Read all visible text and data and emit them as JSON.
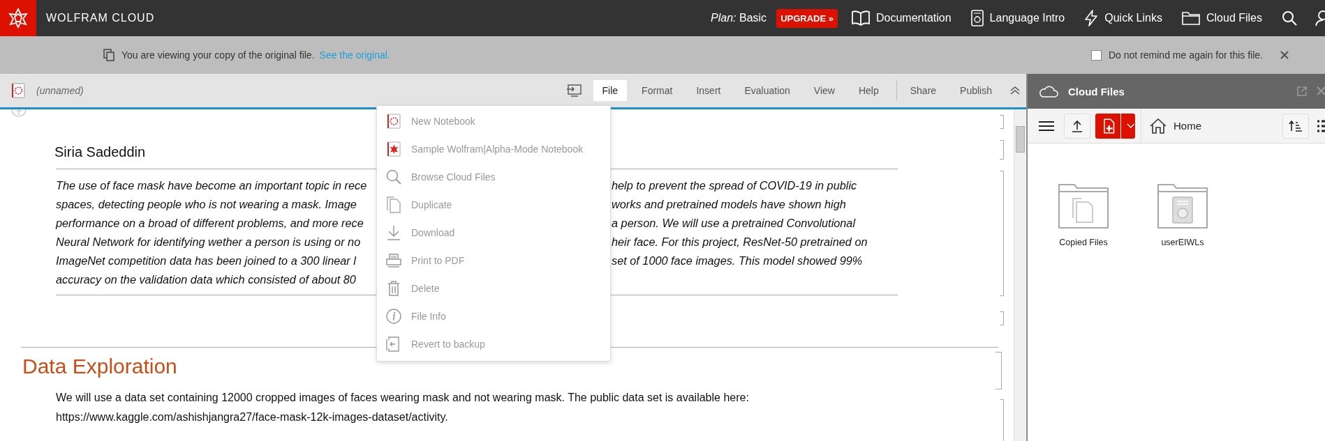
{
  "header": {
    "brand": "WOLFRAM CLOUD",
    "plan_label": "Plan:",
    "plan": "Basic",
    "upgrade": "UPGRADE »",
    "links": [
      {
        "kind": "book",
        "label": "Documentation"
      },
      {
        "kind": "intro",
        "label": "Language Intro"
      },
      {
        "kind": "bolt",
        "label": "Quick Links"
      },
      {
        "kind": "folder",
        "label": "Cloud Files"
      }
    ]
  },
  "notice": {
    "text": "You are viewing your copy of the original file.",
    "link": "See the original.",
    "remind": {
      "label": "Do not remind me again for this file.",
      "checked": false
    }
  },
  "notebook": {
    "title": "(unnamed)",
    "menus": [
      {
        "label": "File",
        "selected": true
      },
      {
        "label": "Format",
        "selected": false
      },
      {
        "label": "Insert",
        "selected": false
      },
      {
        "label": "Evaluation",
        "selected": false
      },
      {
        "label": "View",
        "selected": false
      },
      {
        "label": "Help",
        "selected": false
      }
    ],
    "actions": [
      "Share",
      "Publish"
    ]
  },
  "file_menu": [
    {
      "kind": "notebook",
      "label": "New Notebook",
      "disabled": true
    },
    {
      "kind": "wa-notebook",
      "label": "Sample Wolfram|Alpha-Mode Notebook",
      "disabled": true
    },
    {
      "kind": "search",
      "label": "Browse Cloud Files",
      "disabled": true
    },
    {
      "kind": "duplicate",
      "label": "Duplicate",
      "disabled": true
    },
    {
      "kind": "download",
      "label": "Download",
      "disabled": true
    },
    {
      "kind": "print",
      "label": "Print to PDF",
      "disabled": true
    },
    {
      "kind": "delete",
      "label": "Delete",
      "disabled": true
    },
    {
      "kind": "info",
      "label": "File Info",
      "disabled": true
    },
    {
      "kind": "revert",
      "label": "Revert to backup",
      "disabled": true
    }
  ],
  "cells": {
    "author": "Siria Sadeddin",
    "abstract_lines": [
      {
        "left": "The use of face mask have become an important topic in rece",
        "right": "help to prevent the spread of COVID-19 in public"
      },
      {
        "left": "spaces, detecting people who is not wearing a mask. Image",
        "right": "works and pretrained models have shown high"
      },
      {
        "left": "performance on a broad of different problems, and more rece",
        "right": "a person. We will use a pretrained Convolutional"
      },
      {
        "left": "Neural Network for identifying wether a person is using or no",
        "right": "heir face. For this project, ResNet-50 pretrained on"
      },
      {
        "left": "ImageNet competition data has been joined to a 300 linear l",
        "right": "set of 1000 face images. This model showed 99%"
      },
      {
        "left": "accuracy on the validation data which consisted of about 80"
      }
    ],
    "heading": "Data Exploration",
    "body_lines": [
      "We will use a data set containing 12000 cropped images of faces wearing mask and not wearing mask. The public data set is available here:",
      "https://www.kaggle.com/ashishjangra27/face-mask-12k-images-dataset/activity."
    ]
  },
  "cloud_panel": {
    "title": "Cloud Files",
    "location": "Home",
    "folders": [
      {
        "kind": "copies",
        "name": "Copied Files"
      },
      {
        "kind": "document",
        "name": "userEIWLs"
      }
    ]
  }
}
